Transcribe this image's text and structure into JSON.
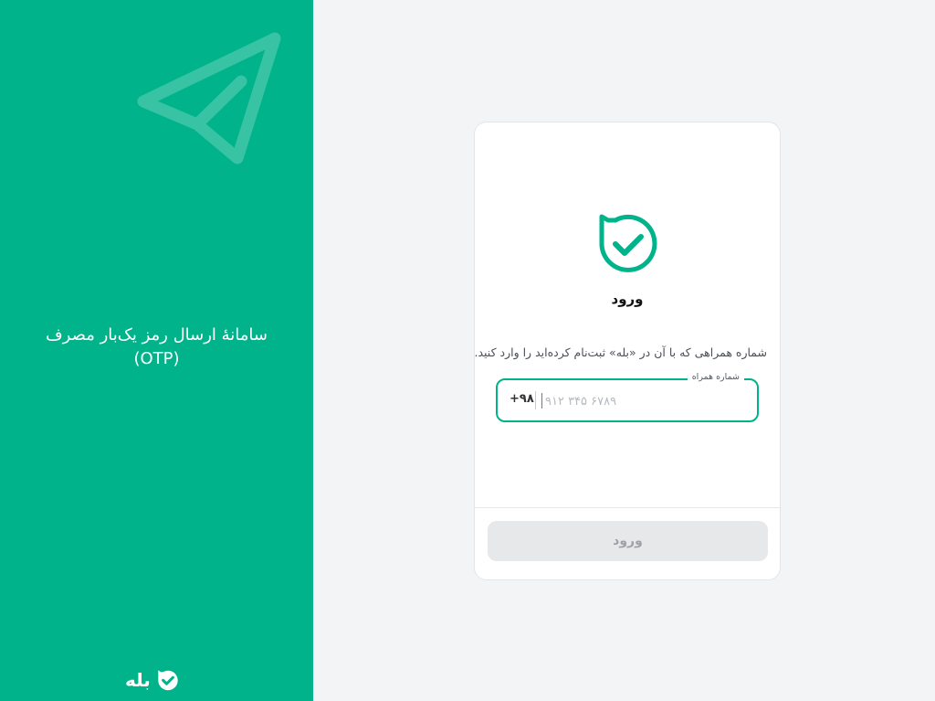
{
  "side_panel": {
    "title_line1": "سامانهٔ ارسال رمز یک‌بار مصرف",
    "title_line2": "(OTP)",
    "brand_name": "بله",
    "plane_icon": "send-plane-icon",
    "brand_icon": "bale-check-icon"
  },
  "login_card": {
    "logo_icon": "bale-check-icon",
    "title": "ورود",
    "instruction": "شماره همراهی که با آن در «بله» ثبت‌نام کرده‌اید را وارد کنید.",
    "phone_field": {
      "label": "شماره همراه",
      "country_code": "+۹۸",
      "placeholder": "۹۱۲ ۳۴۵ ۶۷۸۹",
      "value": ""
    },
    "submit_label": "ورود"
  },
  "colors": {
    "brand_green": "#00b38b",
    "background": "#f3f4f6",
    "button_disabled_bg": "#e7e8ea",
    "button_disabled_text": "#9ea2a8"
  }
}
